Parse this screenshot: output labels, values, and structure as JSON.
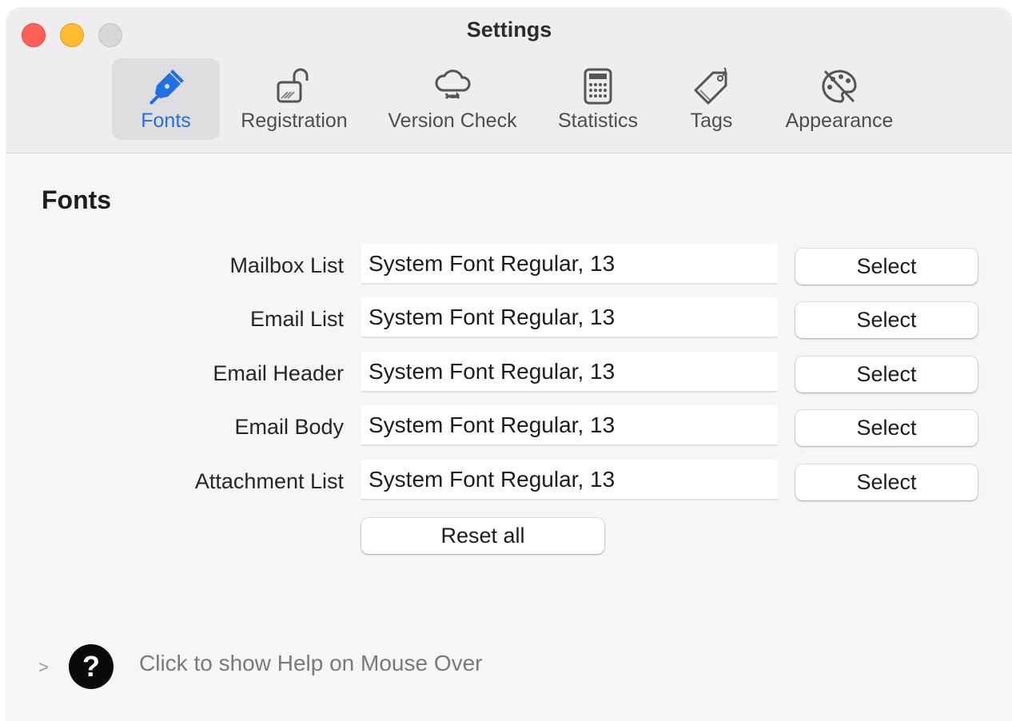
{
  "window": {
    "title": "Settings"
  },
  "tabs": [
    {
      "label": "Fonts",
      "icon": "fountain-pen-icon",
      "selected": true
    },
    {
      "label": "Registration",
      "icon": "open-lock-icon",
      "selected": false
    },
    {
      "label": "Version Check",
      "icon": "cloud-sync-icon",
      "selected": false
    },
    {
      "label": "Statistics",
      "icon": "calculator-icon",
      "selected": false
    },
    {
      "label": "Tags",
      "icon": "tag-icon",
      "selected": false
    },
    {
      "label": "Appearance",
      "icon": "palette-icon",
      "selected": false
    }
  ],
  "section": {
    "title": "Fonts"
  },
  "fonts": [
    {
      "label": "Mailbox List",
      "value": "System Font Regular, 13",
      "button": "Select"
    },
    {
      "label": "Email List",
      "value": "System Font Regular, 13",
      "button": "Select"
    },
    {
      "label": "Email Header",
      "value": "System Font Regular, 13",
      "button": "Select"
    },
    {
      "label": "Email Body",
      "value": "System Font Regular, 13",
      "button": "Select"
    },
    {
      "label": "Attachment List",
      "value": "System Font Regular, 13",
      "button": "Select"
    }
  ],
  "reset_label": "Reset all",
  "help": {
    "chevron": ">",
    "icon_glyph": "?",
    "text": "Click to show Help on Mouse Over"
  },
  "colors": {
    "accent": "#1f6fe5",
    "close": "#fe5f57",
    "minimize": "#febc2e",
    "zoom": "#d8d7d8"
  }
}
